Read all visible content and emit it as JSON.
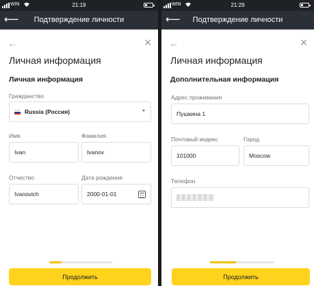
{
  "screens": [
    {
      "status": {
        "carrier": "WIN",
        "time": "21:19"
      },
      "appbar": {
        "back_icon": "arrow-left-icon",
        "title": "Подтверждение личности"
      },
      "page_title": "Личная информация",
      "section_title": "Личная информация",
      "citizenship": {
        "label": "Гражданство",
        "value": "Russia (Россия)",
        "flag_colors": [
          "#ffffff",
          "#1c3f9e",
          "#d52b1e"
        ]
      },
      "first_name": {
        "label": "Имя",
        "value": "Ivan"
      },
      "last_name": {
        "label": "Фамилия",
        "value": "Ivanov"
      },
      "patronymic": {
        "label": "Отчество",
        "value": "Ivanovich"
      },
      "birth_date": {
        "label": "Дата рождения",
        "value": "2000-01-01"
      },
      "progress": 0.2,
      "continue_label": "Продолжить"
    },
    {
      "status": {
        "carrier": "WIN",
        "time": "21:29"
      },
      "appbar": {
        "back_icon": "arrow-left-icon",
        "title": "Подтверждение личности"
      },
      "page_title": "Личная информация",
      "section_title": "Дополнительная информация",
      "address": {
        "label": "Адрес проживания",
        "value": "Пушкина 1"
      },
      "postal_code": {
        "label": "Почтовый индекс",
        "value": "101000"
      },
      "city": {
        "label": "Город",
        "value": "Moscow"
      },
      "phone": {
        "label": "Телефон",
        "value": ""
      },
      "progress": 0.4,
      "continue_label": "Продолжить"
    }
  ],
  "colors": {
    "accent": "#ffd21e",
    "appbar": "#2b3038",
    "statusbar": "#1e2126"
  }
}
